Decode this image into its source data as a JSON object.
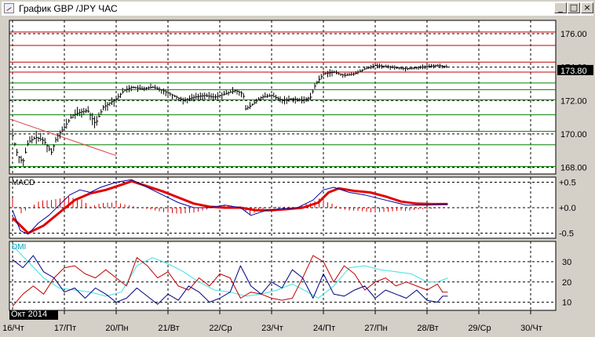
{
  "window": {
    "title": "График GBP /JPY ЧАС",
    "buttons": {
      "minimize": "_",
      "maximize": "□",
      "close": "×"
    }
  },
  "colors": {
    "background": "#ffffff",
    "frame": "#d4d0c8",
    "price_bar": "#000000",
    "support_line": "#008000",
    "resistance_line": "#c00000",
    "trend_line": "#e04040",
    "macd_line": "#0000a0",
    "macd_signal": "#e00000",
    "dmi_adx": "#40e0e0",
    "dmi_plus": "#000080",
    "dmi_minus": "#c00000",
    "grid": "#000000"
  },
  "timeframe_label": "Окт 2014",
  "chart_data": [
    {
      "type": "line",
      "name_label": "",
      "ylim": [
        167.6,
        176.8
      ],
      "y_ticks": [
        "176.00",
        "174.00",
        "172.00",
        "170.00",
        "168.00"
      ],
      "y_tick_values": [
        176,
        174,
        172,
        170,
        168
      ],
      "current_price_label": "173.80",
      "current_price": 173.8,
      "x_tick_labels": [
        "16/Чт",
        "17/Пт",
        "20/Пн",
        "21/Вт",
        "22/Ср",
        "23/Чт",
        "24/Пт",
        "27/Пн",
        "28/Вт",
        "29/Ср",
        "30/Чт"
      ],
      "horizontal_levels": [
        {
          "value": 176.1,
          "color": "resistance"
        },
        {
          "value": 175.3,
          "color": "resistance"
        },
        {
          "value": 174.3,
          "color": "resistance"
        },
        {
          "value": 173.7,
          "color": "resistance"
        },
        {
          "value": 173.05,
          "color": "support"
        },
        {
          "value": 172.65,
          "color": "support"
        },
        {
          "value": 172.05,
          "color": "support"
        },
        {
          "value": 171.15,
          "color": "support"
        },
        {
          "value": 170.15,
          "color": "support"
        },
        {
          "value": 169.35,
          "color": "support"
        },
        {
          "value": 168.05,
          "color": "support"
        }
      ],
      "trend_line": {
        "from": [
          0.0,
          170.9
        ],
        "to": [
          2.0,
          168.7
        ]
      },
      "close_series_keypoints": [
        [
          0.0,
          169.9
        ],
        [
          0.1,
          168.7
        ],
        [
          0.2,
          168.3
        ],
        [
          0.3,
          169.5
        ],
        [
          0.45,
          169.8
        ],
        [
          0.6,
          169.6
        ],
        [
          0.75,
          168.9
        ],
        [
          0.85,
          169.8
        ],
        [
          1.0,
          170.4
        ],
        [
          1.15,
          171.1
        ],
        [
          1.3,
          171.3
        ],
        [
          1.45,
          171.4
        ],
        [
          1.6,
          170.6
        ],
        [
          1.75,
          171.6
        ],
        [
          2.0,
          172.1
        ],
        [
          2.15,
          172.6
        ],
        [
          2.3,
          172.8
        ],
        [
          2.5,
          172.7
        ],
        [
          2.7,
          172.8
        ],
        [
          2.9,
          172.6
        ],
        [
          3.1,
          172.3
        ],
        [
          3.3,
          172.0
        ],
        [
          3.5,
          172.2
        ],
        [
          3.7,
          172.3
        ],
        [
          3.9,
          172.2
        ],
        [
          4.1,
          172.4
        ],
        [
          4.3,
          172.6
        ],
        [
          4.45,
          172.4
        ],
        [
          4.5,
          171.5
        ],
        [
          4.6,
          171.7
        ],
        [
          4.8,
          172.2
        ],
        [
          5.0,
          172.3
        ],
        [
          5.2,
          172.0
        ],
        [
          5.4,
          172.1
        ],
        [
          5.6,
          172.0
        ],
        [
          5.75,
          172.2
        ],
        [
          5.85,
          173.0
        ],
        [
          6.0,
          173.6
        ],
        [
          6.2,
          173.7
        ],
        [
          6.4,
          173.5
        ],
        [
          6.6,
          173.6
        ],
        [
          6.8,
          173.9
        ],
        [
          7.0,
          174.1
        ],
        [
          7.3,
          174.0
        ],
        [
          7.6,
          173.9
        ],
        [
          7.9,
          174.0
        ],
        [
          8.2,
          174.1
        ],
        [
          8.4,
          174.0
        ]
      ]
    },
    {
      "type": "line",
      "name_label": "MACD",
      "ylim": [
        -0.6,
        0.6
      ],
      "y_ticks": [
        "+0.5",
        "+0.0",
        "-0.5"
      ],
      "y_tick_values": [
        0.5,
        0.0,
        -0.5
      ],
      "series": [
        {
          "role": "macd",
          "points": [
            [
              0.0,
              -0.05
            ],
            [
              0.15,
              -0.45
            ],
            [
              0.3,
              -0.52
            ],
            [
              0.5,
              -0.3
            ],
            [
              0.7,
              -0.15
            ],
            [
              0.9,
              0.05
            ],
            [
              1.1,
              0.25
            ],
            [
              1.3,
              0.35
            ],
            [
              1.5,
              0.3
            ],
            [
              1.7,
              0.4
            ],
            [
              2.0,
              0.5
            ],
            [
              2.3,
              0.55
            ],
            [
              2.6,
              0.4
            ],
            [
              2.9,
              0.25
            ],
            [
              3.2,
              0.1
            ],
            [
              3.5,
              0.0
            ],
            [
              3.8,
              0.0
            ],
            [
              4.1,
              0.05
            ],
            [
              4.4,
              0.0
            ],
            [
              4.6,
              -0.15
            ],
            [
              4.9,
              -0.05
            ],
            [
              5.2,
              -0.02
            ],
            [
              5.5,
              0.0
            ],
            [
              5.8,
              0.15
            ],
            [
              6.0,
              0.35
            ],
            [
              6.2,
              0.4
            ],
            [
              6.5,
              0.3
            ],
            [
              6.8,
              0.25
            ],
            [
              7.2,
              0.15
            ],
            [
              7.6,
              0.05
            ],
            [
              8.0,
              0.05
            ],
            [
              8.4,
              0.07
            ]
          ]
        },
        {
          "role": "signal",
          "points": [
            [
              0.0,
              -0.2
            ],
            [
              0.3,
              -0.5
            ],
            [
              0.6,
              -0.35
            ],
            [
              0.9,
              -0.1
            ],
            [
              1.2,
              0.15
            ],
            [
              1.5,
              0.28
            ],
            [
              1.8,
              0.35
            ],
            [
              2.1,
              0.45
            ],
            [
              2.3,
              0.52
            ],
            [
              2.6,
              0.42
            ],
            [
              2.9,
              0.32
            ],
            [
              3.2,
              0.2
            ],
            [
              3.5,
              0.08
            ],
            [
              3.8,
              0.02
            ],
            [
              4.1,
              0.0
            ],
            [
              4.4,
              0.0
            ],
            [
              4.7,
              -0.05
            ],
            [
              5.0,
              -0.05
            ],
            [
              5.3,
              -0.03
            ],
            [
              5.6,
              0.0
            ],
            [
              5.9,
              0.1
            ],
            [
              6.1,
              0.3
            ],
            [
              6.3,
              0.38
            ],
            [
              6.6,
              0.33
            ],
            [
              6.9,
              0.3
            ],
            [
              7.2,
              0.22
            ],
            [
              7.5,
              0.12
            ],
            [
              7.8,
              0.08
            ],
            [
              8.1,
              0.07
            ],
            [
              8.4,
              0.07
            ]
          ]
        }
      ]
    },
    {
      "type": "line",
      "name_label": "DMI",
      "ylim": [
        6,
        40
      ],
      "y_ticks": [
        "30",
        "20",
        "10"
      ],
      "y_tick_values": [
        30,
        20,
        10
      ],
      "series": [
        {
          "role": "adx",
          "points": [
            [
              0.0,
              38
            ],
            [
              0.3,
              30
            ],
            [
              0.6,
              22
            ],
            [
              0.9,
              17
            ],
            [
              1.2,
              16
            ],
            [
              1.5,
              15
            ],
            [
              1.8,
              13
            ],
            [
              2.1,
              15
            ],
            [
              2.4,
              28
            ],
            [
              2.7,
              32
            ],
            [
              3.0,
              29
            ],
            [
              3.3,
              25
            ],
            [
              3.6,
              20
            ],
            [
              3.9,
              16
            ],
            [
              4.2,
              15
            ],
            [
              4.5,
              13
            ],
            [
              4.8,
              14
            ],
            [
              5.1,
              16
            ],
            [
              5.4,
              19
            ],
            [
              5.7,
              15
            ],
            [
              5.9,
              12
            ],
            [
              6.2,
              18
            ],
            [
              6.5,
              27
            ],
            [
              6.8,
              28
            ],
            [
              7.1,
              26
            ],
            [
              7.4,
              25
            ],
            [
              7.7,
              24
            ],
            [
              8.0,
              20
            ],
            [
              8.2,
              20
            ],
            [
              8.4,
              22
            ]
          ]
        },
        {
          "role": "plus_di",
          "points": [
            [
              0.0,
              31
            ],
            [
              0.2,
              27
            ],
            [
              0.4,
              33
            ],
            [
              0.6,
              25
            ],
            [
              0.8,
              22
            ],
            [
              1.0,
              15
            ],
            [
              1.2,
              17
            ],
            [
              1.4,
              12
            ],
            [
              1.6,
              17
            ],
            [
              1.8,
              14
            ],
            [
              2.0,
              10
            ],
            [
              2.2,
              12
            ],
            [
              2.4,
              17
            ],
            [
              2.6,
              13
            ],
            [
              2.8,
              9
            ],
            [
              3.0,
              14
            ],
            [
              3.2,
              11
            ],
            [
              3.4,
              18
            ],
            [
              3.6,
              15
            ],
            [
              3.8,
              10
            ],
            [
              4.0,
              12
            ],
            [
              4.2,
              15
            ],
            [
              4.4,
              28
            ],
            [
              4.6,
              18
            ],
            [
              4.8,
              14
            ],
            [
              5.0,
              20
            ],
            [
              5.2,
              17
            ],
            [
              5.4,
              26
            ],
            [
              5.6,
              22
            ],
            [
              5.8,
              12
            ],
            [
              6.0,
              24
            ],
            [
              6.2,
              14
            ],
            [
              6.4,
              13
            ],
            [
              6.6,
              16
            ],
            [
              6.8,
              18
            ],
            [
              7.0,
              12
            ],
            [
              7.2,
              16
            ],
            [
              7.4,
              14
            ],
            [
              7.6,
              12
            ],
            [
              7.8,
              16
            ],
            [
              8.0,
              11
            ],
            [
              8.2,
              10
            ],
            [
              8.3,
              13
            ],
            [
              8.4,
              13
            ]
          ]
        },
        {
          "role": "minus_di",
          "points": [
            [
              0.0,
              8
            ],
            [
              0.2,
              14
            ],
            [
              0.4,
              18
            ],
            [
              0.6,
              14
            ],
            [
              0.8,
              22
            ],
            [
              1.0,
              27
            ],
            [
              1.2,
              28
            ],
            [
              1.4,
              24
            ],
            [
              1.6,
              22
            ],
            [
              1.8,
              26
            ],
            [
              2.0,
              22
            ],
            [
              2.2,
              18
            ],
            [
              2.4,
              32
            ],
            [
              2.6,
              28
            ],
            [
              2.8,
              22
            ],
            [
              3.0,
              25
            ],
            [
              3.2,
              18
            ],
            [
              3.4,
              16
            ],
            [
              3.6,
              22
            ],
            [
              3.8,
              18
            ],
            [
              4.0,
              24
            ],
            [
              4.2,
              22
            ],
            [
              4.4,
              12
            ],
            [
              4.6,
              15
            ],
            [
              4.8,
              14
            ],
            [
              5.0,
              12
            ],
            [
              5.2,
              11
            ],
            [
              5.4,
              12
            ],
            [
              5.6,
              22
            ],
            [
              5.8,
              33
            ],
            [
              6.0,
              30
            ],
            [
              6.2,
              20
            ],
            [
              6.4,
              28
            ],
            [
              6.6,
              24
            ],
            [
              6.8,
              16
            ],
            [
              7.0,
              20
            ],
            [
              7.2,
              22
            ],
            [
              7.4,
              18
            ],
            [
              7.6,
              20
            ],
            [
              7.8,
              18
            ],
            [
              8.0,
              16
            ],
            [
              8.2,
              19
            ],
            [
              8.3,
              15
            ],
            [
              8.4,
              15
            ]
          ]
        }
      ]
    }
  ]
}
